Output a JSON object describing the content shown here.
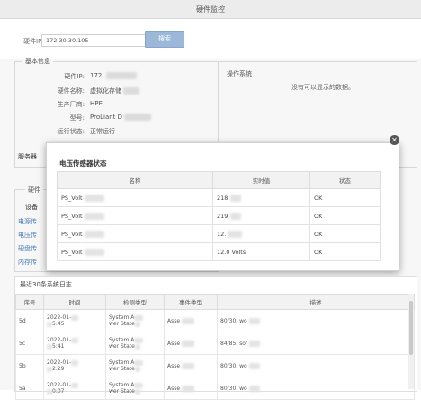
{
  "window": {
    "title": "硬件监控"
  },
  "search": {
    "label": "硬件IP",
    "value": "172.30.30.105",
    "button": "搜索"
  },
  "basic_info": {
    "legend": "基本信息",
    "rows": [
      {
        "key": "硬件IP:",
        "value": "172."
      },
      {
        "key": "硬件名称:",
        "value": "虚拟化存储"
      },
      {
        "key": "生产厂商:",
        "value": "HPE"
      },
      {
        "key": "型号:",
        "value": "ProLiant D"
      },
      {
        "key": "运行状态:",
        "value": "正常运行"
      }
    ],
    "partial_left_1": "服务器",
    "partial_left_2": "硬件",
    "partial_left_3": "设备"
  },
  "os_panel": {
    "title": "操作系统",
    "empty": "没有可以显示的数据。"
  },
  "side_links": [
    "电源传",
    "电压传",
    "硬盘传",
    "内存传"
  ],
  "modal": {
    "title": "电压传感器状态",
    "columns": [
      "名称",
      "实时值",
      "状态"
    ],
    "rows": [
      {
        "name": "PS_Volt",
        "value": "218",
        "status": "OK"
      },
      {
        "name": "PS_Volt",
        "value": "219",
        "status": "OK"
      },
      {
        "name": "PS_Volt",
        "value": "12.",
        "status": "OK"
      },
      {
        "name": "PS_Volt",
        "value": "12.0 Volts",
        "status": "OK"
      }
    ],
    "close_glyph": "✕"
  },
  "log": {
    "title": "最近30条系统日志",
    "columns": [
      "序号",
      "时间",
      "检测类型",
      "事件类型",
      "描述"
    ],
    "rows": [
      {
        "id": "5d",
        "time1": "2022-01-",
        "time2": "5:45",
        "type1": "System A",
        "type2": "wer State",
        "event": "Asse",
        "desc": "80/30. wo"
      },
      {
        "id": "5c",
        "time1": "2022-01-",
        "time2": "5:41",
        "type1": "System A",
        "type2": "wer State",
        "event": "Asse",
        "desc": "84/85. sof"
      },
      {
        "id": "5b",
        "time1": "2022-01-",
        "time2": "2:29",
        "type1": "System A",
        "type2": "wer State",
        "event": "Asse",
        "desc": "80/30. wo"
      },
      {
        "id": "5a",
        "time1": "2022-01-",
        "time2": "0:07",
        "type1": "System A",
        "type2": "wer State",
        "event": "Asse",
        "desc": "80/30. wo"
      }
    ]
  },
  "colors": {
    "accent": "#9bb8d9",
    "link": "#4a7fbf"
  }
}
